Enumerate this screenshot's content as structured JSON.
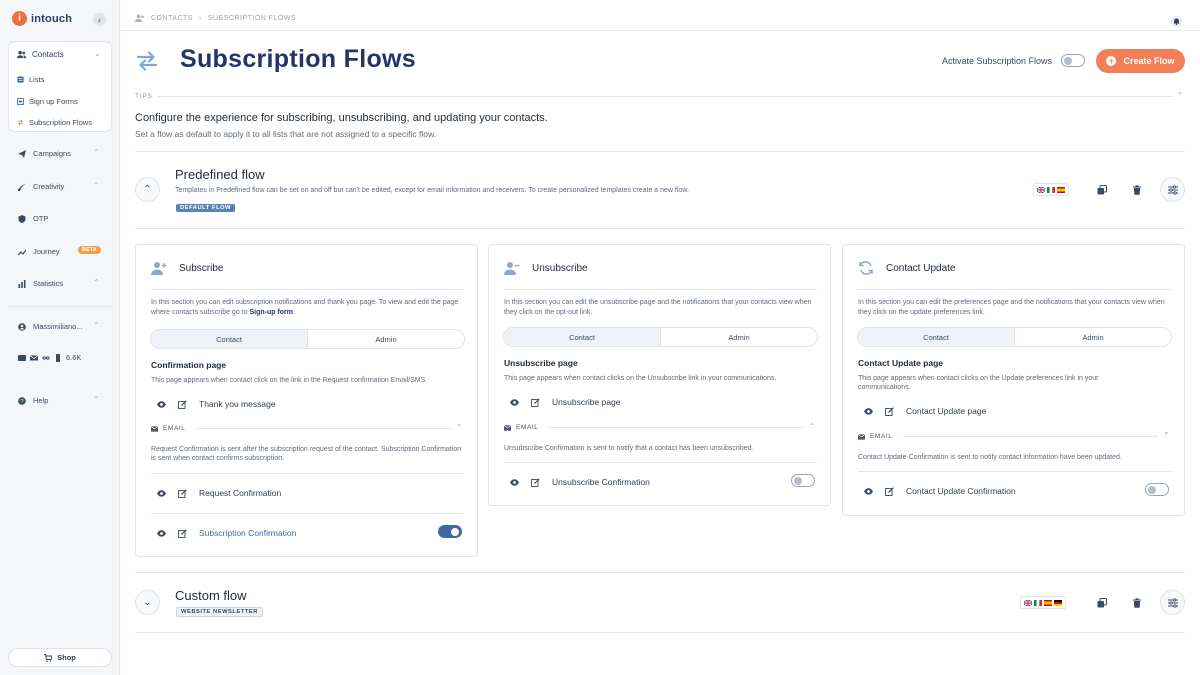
{
  "app": {
    "logo_text": "intouch"
  },
  "sidebar": {
    "contacts_label": "Contacts",
    "sub_items": [
      {
        "label": "Lists",
        "icon": "list-icon"
      },
      {
        "label": "Sign up Forms",
        "icon": "form-icon"
      },
      {
        "label": "Subscription Flows",
        "icon": "flow-icon"
      }
    ],
    "items": [
      {
        "label": "Campaigns",
        "icon": "send-icon"
      },
      {
        "label": "Creativity",
        "icon": "brush-icon"
      },
      {
        "label": "OTP",
        "icon": "shield-icon"
      },
      {
        "label": "Journey",
        "icon": "journey-icon",
        "badge": "BETA"
      },
      {
        "label": "Statistics",
        "icon": "chart-icon"
      },
      {
        "label": "Massimiliano...",
        "icon": "user-icon"
      },
      {
        "label": "6.6K",
        "icon": "credits-icon"
      },
      {
        "label": "Help",
        "icon": "help-icon"
      }
    ],
    "shop_label": "Shop"
  },
  "breadcrumb": {
    "root": "CONTACTS",
    "current": "SUBSCRIPTION FLOWS"
  },
  "header": {
    "title": "Subscription Flows",
    "activate_label": "Activate Subscription Flows",
    "activate_on": false,
    "create_label": "Create Flow"
  },
  "tips": {
    "label": "TIPS",
    "title": "Configure the experience for subscribing, unsubscribing, and updating your contacts.",
    "subtitle": "Set a flow as default to apply it to all lists that are not assigned to a specific flow."
  },
  "predefined_flow": {
    "title": "Predefined flow",
    "description": "Templates in Predefined flow can be set on and off but can't be edited, except for email information and receivers. To create personalized templates create a new flow.",
    "badge": "DEFAULT FLOW",
    "languages": [
      "en",
      "it",
      "es"
    ]
  },
  "cards": {
    "subscribe": {
      "title": "Subscribe",
      "desc_a": "In this section you can edit subscription notifications and thank you page. To view and edit the page where contacts  subscribe go to ",
      "desc_link": "Sign-up form",
      "desc_b": ".",
      "tab_contact": "Contact",
      "tab_admin": "Admin",
      "page_title": "Confirmation page",
      "page_desc": "This page appears when contact click on the link in the Request confirmation Email/SMS.",
      "page_item": "Thank you message",
      "email_label": "EMAIL",
      "email_desc": "Request Confirmation is sent after the subscription request of the contact. Subscription Confirmation is sent when contact confirms subscription.",
      "email_item_1": "Request Confirmation",
      "email_item_2": "Subscription Confirmation",
      "email_item_2_on": true
    },
    "unsubscribe": {
      "title": "Unsubscribe",
      "desc": "In this section you can edit the unsubscribe page and the notifications that your contacts view when they click on the opt-out link.",
      "tab_contact": "Contact",
      "tab_admin": "Admin",
      "page_title": "Unsubscribe page",
      "page_desc": "This page appears when contact clicks on the Unsubscribe link in your communications.",
      "page_item": "Unsubscribe page",
      "email_label": "EMAIL",
      "email_desc": "Unsubscribe Confirmation is sent to notify that a contact has been unsubscribed.",
      "email_item_1": "Unsubscribe Confirmation",
      "email_item_1_on": false
    },
    "contact_update": {
      "title": "Contact Update",
      "desc": "In this section you can edit the preferences page and the notifications that your contacts view when they click on the update preferences link.",
      "tab_contact": "Contact",
      "tab_admin": "Admin",
      "page_title": "Contact Update page",
      "page_desc": "This page appears when contact clicks on the Update preferences link in your communications.",
      "page_item": "Contact Update page",
      "email_label": "EMAIL",
      "email_desc": "Contact Update Confirmation is sent to notify contact information have been updated.",
      "email_item_1": "Contact Update Confirmation",
      "email_item_1_on": false
    }
  },
  "custom_flow": {
    "title": "Custom flow",
    "badge": "WEBSITE NEWSLETTER",
    "languages": [
      "en",
      "it",
      "es",
      "de"
    ]
  },
  "colors": {
    "accent": "#f27f57",
    "primary": "#24346a",
    "toggle_on": "#3e6aa1",
    "badge_default": "#5b84b6"
  }
}
